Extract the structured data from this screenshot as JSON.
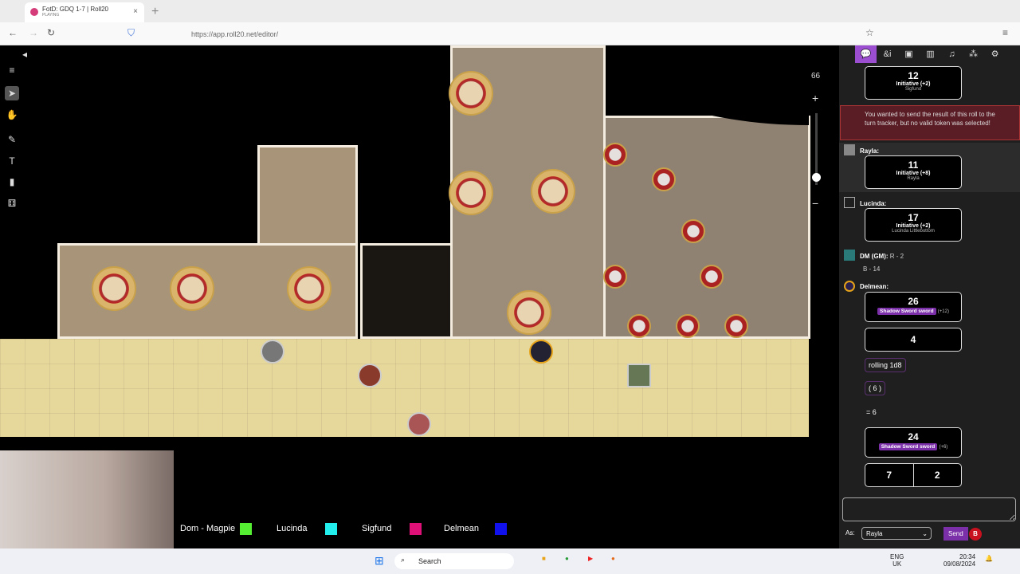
{
  "browser": {
    "tab_title": "FotD: GDQ 1-7 | Roll20",
    "tab_sub": "PLAYING",
    "url": "https://app.roll20.net/editor/"
  },
  "canvas": {
    "zoom": "66"
  },
  "legend": [
    {
      "name": "Dom - Magpie",
      "color": "#55ee33"
    },
    {
      "name": "Lucinda",
      "color": "#22eeee"
    },
    {
      "name": "Sigfund",
      "color": "#dd1177"
    },
    {
      "name": "Delmean",
      "color": "#1111ee"
    }
  ],
  "chat": {
    "sigfund": {
      "value": "12",
      "label": "Initiative (+2)",
      "sub": "Sigfund"
    },
    "error": "You wanted to send the result of this roll to the turn tracker, but no valid token was selected!",
    "rayla": {
      "who": "Rayla:",
      "value": "11",
      "label": "Initiative (+8)",
      "sub": "Rayla"
    },
    "lucinda": {
      "who": "Lucinda:",
      "value": "17",
      "label": "Initiative (+2)",
      "sub": "Lucinda Littlebottom"
    },
    "dm": {
      "who": "DM (GM):",
      "line1": "R - 2",
      "line2": "B - 14"
    },
    "delmean": {
      "who": "Delmean:",
      "attack1": "26",
      "weapon1": "Shadow Sword sword",
      "mod1": "(+12)",
      "dmg1": "4",
      "rolling": "rolling 1d8",
      "paren": "( 6 )",
      "eq": "= 6",
      "attack2": "24",
      "weapon2": "Shadow Sword sword",
      "mod2": "(+6)",
      "dmgA": "7",
      "dmgB": "2"
    },
    "as_label": "As:",
    "as_value": "Rayla",
    "send": "Send"
  },
  "taskbar": {
    "search": "Search",
    "lang1": "ENG",
    "lang2": "UK",
    "time": "20:34",
    "date": "09/08/2024"
  }
}
